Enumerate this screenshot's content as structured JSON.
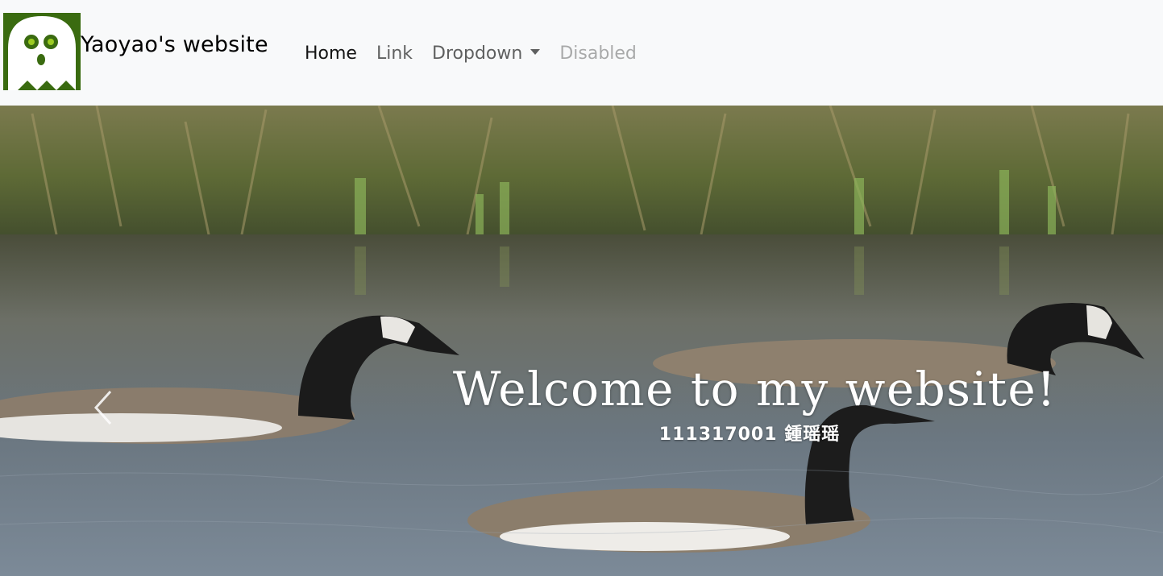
{
  "navbar": {
    "brand_text": "Yaoyao's website",
    "logo_icon": "ghost-icon",
    "links": [
      {
        "label": "Home",
        "state": "active"
      },
      {
        "label": "Link",
        "state": "normal"
      },
      {
        "label": "Dropdown",
        "state": "normal",
        "has_caret": true
      },
      {
        "label": "Disabled",
        "state": "disabled"
      }
    ]
  },
  "carousel": {
    "title": "Welcome to my website!",
    "subtitle": "111317001 鍾瑶瑶",
    "prev_icon": "chevron-left-icon"
  },
  "colors": {
    "navbar_bg": "#f8f9fa",
    "logo_bg": "#3a6b10",
    "caption_text": "#ffffff"
  }
}
